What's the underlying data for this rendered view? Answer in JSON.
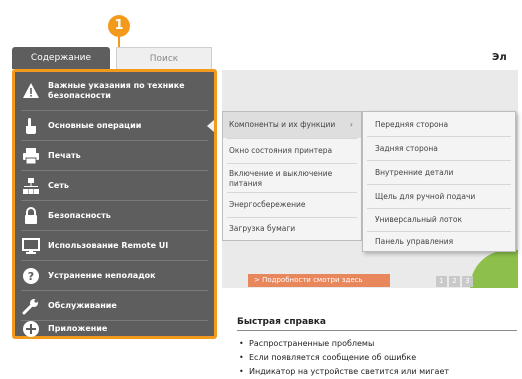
{
  "callout": {
    "number": "1"
  },
  "tabs": [
    {
      "label": "Содержание"
    },
    {
      "label": "Поиск"
    }
  ],
  "sidebar": {
    "items": [
      {
        "label": "Важные указания по технике безопасности",
        "icon": "warning-icon"
      },
      {
        "label": "Основные операции",
        "icon": "hand-icon"
      },
      {
        "label": "Печать",
        "icon": "printer-icon"
      },
      {
        "label": "Сеть",
        "icon": "network-icon"
      },
      {
        "label": "Безопасность",
        "icon": "lock-icon"
      },
      {
        "label": "Использование Remote UI",
        "icon": "monitor-icon"
      },
      {
        "label": "Устранение неполадок",
        "icon": "help-icon"
      },
      {
        "label": "Обслуживание",
        "icon": "wrench-icon"
      },
      {
        "label": "Приложение",
        "icon": "plus-icon"
      }
    ]
  },
  "flyout1": {
    "items": [
      {
        "label": "Компоненты и их функции"
      },
      {
        "label": "Окно состояния принтера"
      },
      {
        "label": "Включение и выключение питания"
      },
      {
        "label": "Энергосбережение"
      },
      {
        "label": "Загрузка бумаги"
      }
    ]
  },
  "flyout2": {
    "items": [
      {
        "label": "Передняя сторона"
      },
      {
        "label": "Задняя сторона"
      },
      {
        "label": "Внутренние детали"
      },
      {
        "label": "Щель для ручной подачи"
      },
      {
        "label": "Универсальный лоток"
      },
      {
        "label": "Панель управления"
      }
    ]
  },
  "main": {
    "heading": "Эл",
    "banner_more_link": "> Подробности смотри здесь",
    "pager": [
      "1",
      "2",
      "3"
    ],
    "quick": {
      "title": "Быстрая справка",
      "items": [
        "Распространенные проблемы",
        "Если появляется сообщение об ошибке",
        "Индикатор на устройстве светится или мигает"
      ]
    }
  },
  "colors": {
    "accent": "#f39a1d",
    "sidebar_bg": "#5e5e5e",
    "link_bg": "#e8865c"
  }
}
